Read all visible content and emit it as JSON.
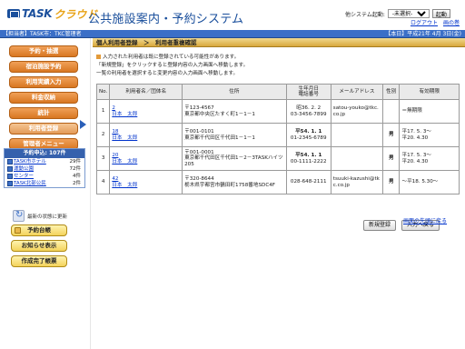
{
  "header": {
    "logo_main": "TASK",
    "logo_sub": "クラウド",
    "system_title": "公共施設案内・予約システム",
    "system_start_label": "他システム起動:",
    "system_select_value": "-未選択-",
    "start_button": "起動",
    "logout_link": "ログアウト",
    "kanri_link": "画の巻"
  },
  "infobar": {
    "left": "【担当者】TASK市：TKC管理者",
    "right": "【本日】平成21年 4月 3日(金)"
  },
  "sidebar": {
    "menu": [
      {
        "label": "予約・抽選",
        "state": "normal"
      },
      {
        "label": "宿泊施設予約",
        "state": "normal"
      },
      {
        "label": "利用実績入力",
        "state": "normal"
      },
      {
        "label": "料金収納",
        "state": "normal"
      },
      {
        "label": "統計",
        "state": "normal"
      },
      {
        "label": "利用者登録",
        "state": "active"
      },
      {
        "label": "管理者メニュー",
        "state": "normal"
      }
    ],
    "reserve_title": "予約申込: 107件",
    "reserve_items": [
      {
        "name": "TASK市ホテル",
        "count": "29件"
      },
      {
        "name": "運動公園",
        "count": "72件"
      },
      {
        "name": "センター",
        "count": "4件"
      },
      {
        "name": "TASK北部公民",
        "count": "2件"
      }
    ],
    "refresh_label": "最新の状態に更新",
    "yellow_buttons": [
      "予約台帳",
      "お知らせ表示",
      "作成完了帳票"
    ]
  },
  "main": {
    "title": "個人利用者登録　＞　利用者重複確認",
    "messages": [
      "入力された利用者は既に登録されている可能性があります。",
      "「新規登録」をクリックすると登録内容の入力画面へ移動します。",
      "一覧の利用者を選択すると変更内容の入力画面へ移動します。"
    ],
    "table": {
      "headers": [
        "No.",
        "利用者名／団体名",
        "住所",
        "生年月日\n電話番号",
        "メールアドレス",
        "性別",
        "有効期限"
      ],
      "rows": [
        {
          "no": "1",
          "id": "2",
          "name": "日本　太郎",
          "zip": "〒123-4567",
          "address": "東京都中央区たすく町1－1－1",
          "birth": "昭36. 2. 2",
          "phone": "03-3456-7899",
          "email": "satou-youko@tkc.co.jp",
          "gender": "",
          "expiry": "＝無期限"
        },
        {
          "no": "2",
          "id": "18",
          "name": "日本　太郎",
          "zip": "〒001-0101",
          "address": "東京都千代田区千代田1－1－1",
          "birth": "平54. 1. 1",
          "phone": "01-2345-6789",
          "email": "",
          "gender": "男",
          "expiry": "平17. 5. 3～\n平20. 4.30"
        },
        {
          "no": "3",
          "id": "20",
          "name": "日本　太郎",
          "zip": "〒001-0001",
          "address": "東京都千代田区千代田1－2－3TASKハイツ205",
          "birth": "平54. 1. 1",
          "phone": "00-1111-2222",
          "email": "",
          "gender": "男",
          "expiry": "平17. 5. 3～\n平20. 4.30"
        },
        {
          "no": "4",
          "id": "42",
          "name": "日本　太郎",
          "zip": "〒320-8644",
          "address": "栃木県宇都宮市鶴田町1758番地SDC4F",
          "birth": "",
          "phone": "028-648-2111",
          "email": "tsuuki-kazushi@tkc.co.jp",
          "gender": "男",
          "expiry": "～平18. 5.30～"
        }
      ]
    },
    "buttons": {
      "new": "新規登録",
      "back": "入力へ戻る"
    },
    "pagetop": "画面の先頭に戻る"
  }
}
